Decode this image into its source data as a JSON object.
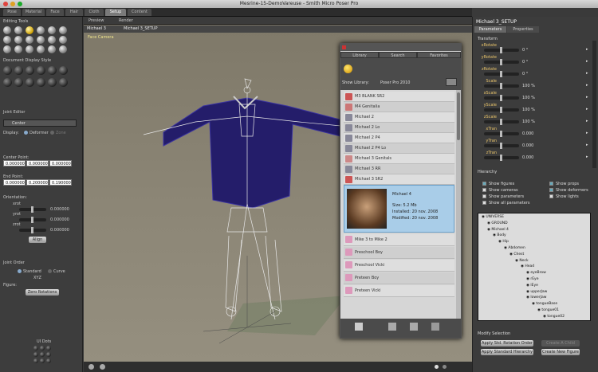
{
  "window": {
    "title": "Mesrine-15-DemoVareuse - Smith Micro Poser Pro"
  },
  "main_tabs": [
    "Pose",
    "Material",
    "Face",
    "Hair",
    "Cloth",
    "Setup",
    "Content"
  ],
  "active_tab": "Setup",
  "left": {
    "editing_tools": "Editing Tools",
    "document_display": "Document Display Style",
    "joint_editor": "Joint Editor",
    "joint_select": "Center",
    "display_label": "Display:",
    "deformer_label": "Deformer",
    "zone_label": "Zone",
    "center_point": "Center Point:",
    "center_vals": [
      "0.000000",
      "0.000000",
      "0.000000"
    ],
    "end_point": "End Point:",
    "end_vals": [
      "0.000000",
      "0.200000",
      "0.190000"
    ],
    "orientation": "Orientation:",
    "orient_axes": [
      "xrot",
      "yrot",
      "zrot"
    ],
    "orient_vals": [
      "0.000000",
      "0.000000",
      "0.000000"
    ],
    "align_btn": "Align",
    "joint_order": "Joint Order",
    "standard": "Standard",
    "curve": "Curve",
    "order_value": "XYZ",
    "figure_label": "Figure:",
    "zero_btn": "Zero Rotations",
    "ui_dots": "UI Dots"
  },
  "viewport": {
    "preview_tab": "Preview",
    "render_tab": "Render",
    "figure_menu": "Michael 3",
    "actor_menu": "Michael 3_SETUP",
    "camera_label": "Face Camera"
  },
  "library": {
    "tabs": [
      "Library",
      "Search",
      "Favorites"
    ],
    "show_library_label": "Show Library:",
    "show_library_value": "Poser Pro 2010",
    "items": [
      "M3 BLANK SR2",
      "M4 Genitalia",
      "Michael 2",
      "Michael 2 Lo",
      "Michael 2 P4",
      "Michael 2 P4 Lo",
      "Michael 3 Genitals",
      "Michael 3 RR",
      "Michael 3 SR2"
    ],
    "selected": {
      "name": "Michael 4",
      "size": "Size: 5.2 Mb",
      "installed": "Installed: 20 nov. 2008",
      "modified": "Modified: 20 nov. 2008"
    },
    "items_after": [
      "Mike 3 to Mike 2",
      "Preschool Boy",
      "Preschool Vicki",
      "Preteen Boy",
      "Preteen Vicki"
    ]
  },
  "right": {
    "header": "Michael 3_SETUP",
    "tabs": [
      "Parameters",
      "Properties"
    ],
    "transform_label": "Transform",
    "params": [
      {
        "label": "xRotate",
        "value": "0 °"
      },
      {
        "label": "yRotate",
        "value": "0 °"
      },
      {
        "label": "zRotate",
        "value": "0 °"
      },
      {
        "label": "Scale",
        "value": "100 %"
      },
      {
        "label": "xScale",
        "value": "100 %"
      },
      {
        "label": "yScale",
        "value": "100 %"
      },
      {
        "label": "zScale",
        "value": "100 %"
      },
      {
        "label": "xTran",
        "value": "0.000"
      },
      {
        "label": "yTran",
        "value": "0.000"
      },
      {
        "label": "zTran",
        "value": "0.000"
      }
    ],
    "hierarchy_label": "Hierarchy",
    "checks": [
      {
        "label": "Show figures",
        "checked": true
      },
      {
        "label": "Show props",
        "checked": true
      },
      {
        "label": "Show cameras",
        "checked": false
      },
      {
        "label": "Show deformers",
        "checked": true
      },
      {
        "label": "Show parameters",
        "checked": false
      },
      {
        "label": "Show lights",
        "checked": false
      },
      {
        "label": "Show all parameters",
        "checked": false
      }
    ],
    "tree": [
      {
        "label": "UNIVERSE",
        "depth": 0
      },
      {
        "label": "GROUND",
        "depth": 1
      },
      {
        "label": "Michael 4",
        "depth": 1
      },
      {
        "label": "Body",
        "depth": 2
      },
      {
        "label": "Hip",
        "depth": 3
      },
      {
        "label": "Abdomen",
        "depth": 4
      },
      {
        "label": "Chest",
        "depth": 5
      },
      {
        "label": "Neck",
        "depth": 6
      },
      {
        "label": "Head",
        "depth": 7
      },
      {
        "label": "eyeBrow",
        "depth": 8
      },
      {
        "label": "rEye",
        "depth": 8
      },
      {
        "label": "lEye",
        "depth": 8
      },
      {
        "label": "upperJaw",
        "depth": 8
      },
      {
        "label": "lowerJaw",
        "depth": 8
      },
      {
        "label": "tongueBase",
        "depth": 9
      },
      {
        "label": "tongue01",
        "depth": 10
      },
      {
        "label": "tongue02",
        "depth": 11
      }
    ],
    "modify_label": "Modify Selection",
    "btn_apply_std_rot": "Apply Std. Rotation Order",
    "btn_create_child": "Create A Child",
    "btn_apply_std_hier": "Apply Standard Hierarchy",
    "btn_create_figure": "Create New Figure"
  }
}
